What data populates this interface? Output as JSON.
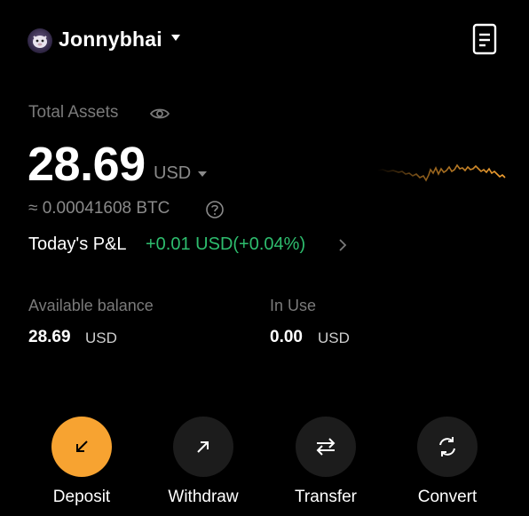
{
  "header": {
    "username": "Jonnybhai"
  },
  "assets": {
    "label": "Total Assets",
    "amount": "28.69",
    "currency": "USD",
    "btc_equivalent": "≈ 0.00041608 BTC"
  },
  "pnl": {
    "label": "Today's P&L",
    "value": "+0.01 USD(+0.04%)"
  },
  "balances": {
    "available": {
      "label": "Available balance",
      "amount": "28.69",
      "currency": "USD"
    },
    "in_use": {
      "label": "In Use",
      "amount": "0.00",
      "currency": "USD"
    }
  },
  "actions": [
    {
      "label": "Deposit",
      "icon": "arrow-down-left-icon"
    },
    {
      "label": "Withdraw",
      "icon": "arrow-up-right-icon"
    },
    {
      "label": "Transfer",
      "icon": "swap-arrows-icon"
    },
    {
      "label": "Convert",
      "icon": "refresh-icon"
    }
  ],
  "colors": {
    "background": "#000000",
    "accent": "#f7a331",
    "positive": "#2ebd6e",
    "muted": "#7a7a7a",
    "button_bg": "#1c1c1c"
  }
}
